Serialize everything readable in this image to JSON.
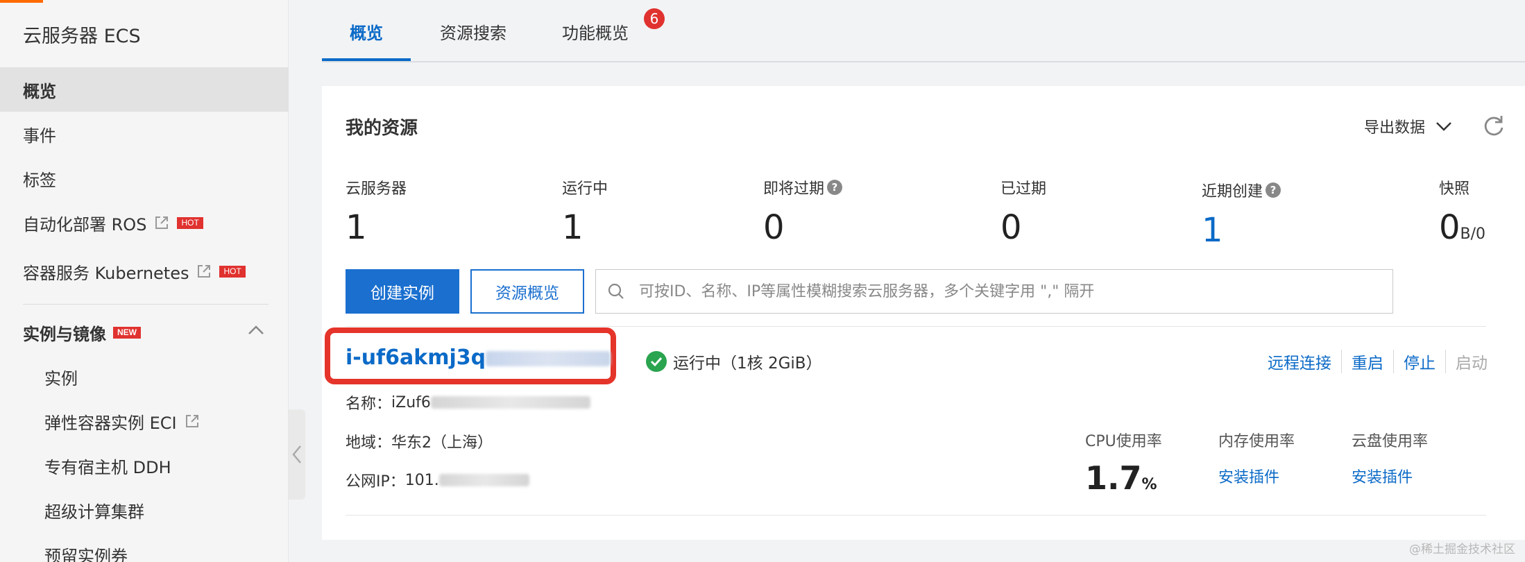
{
  "sidebar": {
    "title": "云服务器 ECS",
    "items": [
      {
        "label": "概览",
        "active": true
      },
      {
        "label": "事件"
      },
      {
        "label": "标签"
      },
      {
        "label": "自动化部署 ROS",
        "badge": "HOT",
        "external": true
      },
      {
        "label": "容器服务 Kubernetes",
        "badge": "HOT",
        "external": true
      }
    ],
    "section": {
      "label": "实例与镜像",
      "badge": "NEW"
    },
    "sub_items": [
      {
        "label": "实例"
      },
      {
        "label": "弹性容器实例 ECI",
        "external": true
      },
      {
        "label": "专有宿主机 DDH"
      },
      {
        "label": "超级计算集群"
      },
      {
        "label": "预留实例券"
      }
    ]
  },
  "tabs": [
    {
      "label": "概览",
      "active": true
    },
    {
      "label": "资源搜索"
    },
    {
      "label": "功能概览",
      "badge": "6"
    }
  ],
  "resources": {
    "title": "我的资源",
    "export_label": "导出数据",
    "stats": [
      {
        "label": "云服务器",
        "value": "1"
      },
      {
        "label": "运行中",
        "value": "1"
      },
      {
        "label": "即将过期",
        "value": "0",
        "help": "?"
      },
      {
        "label": "已过期",
        "value": "0"
      },
      {
        "label": "近期创建",
        "value": "1",
        "help": "?"
      },
      {
        "label": "快照",
        "value": "0",
        "unit": "B/0"
      }
    ],
    "create_button": "创建实例",
    "overview_button": "资源概览",
    "search_placeholder": "可按ID、名称、IP等属性模糊搜索云服务器，多个关键字用 \",\" 隔开"
  },
  "instance": {
    "id_prefix": "i-uf6akmj3q",
    "status": "运行中（1核 2GiB）",
    "actions": [
      "远程连接",
      "重启",
      "停止",
      "启动"
    ],
    "name_label": "名称：",
    "name_prefix": "iZuf6",
    "region_label": "地域：",
    "region": "华东2（上海）",
    "ip_label": "公网IP：",
    "ip_prefix": "101.",
    "cpu_label": "CPU使用率",
    "cpu_value": "1.7",
    "cpu_unit": "%",
    "mem_label": "内存使用率",
    "mem_link": "安装插件",
    "disk_label": "云盘使用率",
    "disk_link": "安装插件"
  },
  "watermark": "@稀土掘金技术社区",
  "colors": {
    "accent": "#0b6ac7",
    "primary_button": "#1a6fcf",
    "badge": "#e0322f",
    "highlight": "#e5342a",
    "success": "#2aa44f"
  }
}
